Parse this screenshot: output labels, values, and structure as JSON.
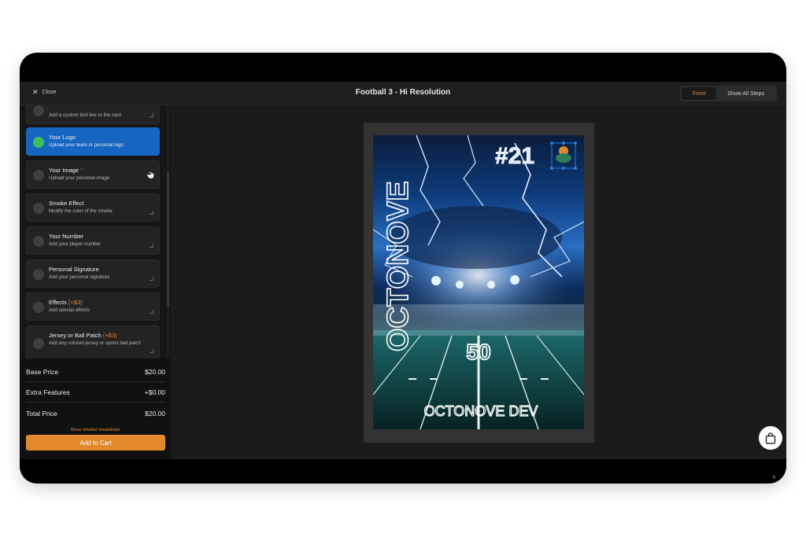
{
  "app": {
    "close_label": "Close",
    "title": "Football 3 - Hi Resolution",
    "view_toggle": {
      "front_label": "Front",
      "all_steps_label": "Show All Steps"
    }
  },
  "steps": [
    {
      "name": "",
      "desc": "Add a custom text line to the card"
    },
    {
      "name": "Your Logo",
      "desc": "Upload your team or personal logo",
      "active": true
    },
    {
      "name": "Your Image",
      "required_mark": "*",
      "desc": "Upload your personal image"
    },
    {
      "name": "Smoke Effect",
      "desc": "Modify the color of the smoke"
    },
    {
      "name": "Your Number",
      "desc": "Add your player number"
    },
    {
      "name": "Personal Signature",
      "desc": "Add your personal signature"
    },
    {
      "name": "Effects",
      "extra": "(+$3)",
      "desc": "Add special effects"
    },
    {
      "name": "Jersey or Ball Patch",
      "extra": "(+$3)",
      "desc": "Add any colored jersey or sports ball patch"
    }
  ],
  "pricing": {
    "base_label": "Base Price",
    "base_value": "$20.00",
    "extra_label": "Extra Features",
    "extra_value": "+$0.00",
    "total_label": "Total Price",
    "total_value": "$20.00",
    "breakdown_link": "Show detailed breakdown",
    "add_to_cart": "Add to Cart"
  },
  "card": {
    "vertical_text": "OCTONOVE",
    "number": "#21",
    "bottom_text": "OCTONOVE DEV",
    "yard_marker": "50"
  },
  "cart": {
    "count": "0",
    "icon": "shopping-bag-icon"
  },
  "colors": {
    "accent": "#e2892b",
    "active_step": "#1665c1",
    "logo_dot": "#3fbf5a"
  }
}
